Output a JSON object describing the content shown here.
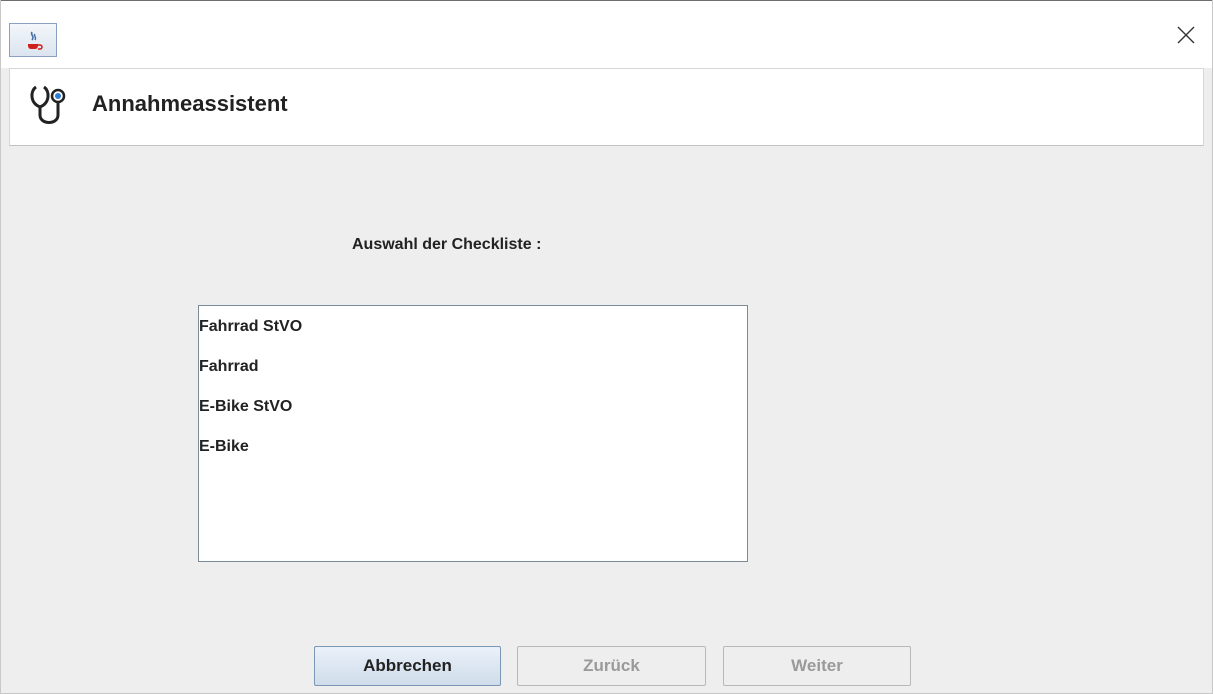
{
  "window": {
    "title": "",
    "app_icon": "java-coffee-icon",
    "close_icon": "close-icon"
  },
  "header": {
    "icon": "stethoscope-icon",
    "title": "Annahmeassistent"
  },
  "main": {
    "prompt": "Auswahl der Checkliste :",
    "checklists": [
      "Fahrrad StVO",
      "Fahrrad",
      "E-Bike StVO",
      "E-Bike"
    ]
  },
  "buttons": {
    "cancel": "Abbrechen",
    "back": "Zurück",
    "next": "Weiter"
  },
  "colors": {
    "background": "#eeeeee",
    "primary_button": "#cfdcea",
    "accent": "#2a7fd4"
  }
}
